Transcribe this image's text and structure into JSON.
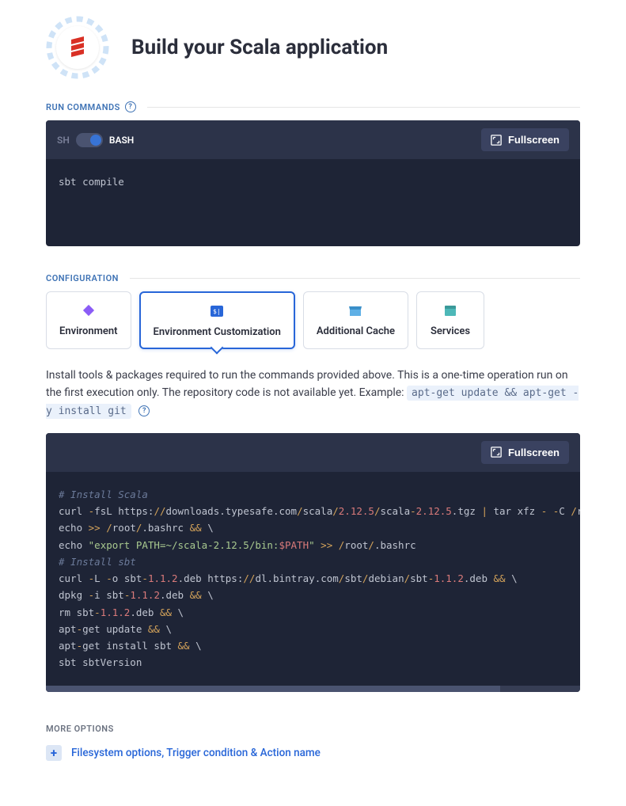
{
  "header": {
    "title": "Build your Scala application"
  },
  "run_commands": {
    "section_label": "RUN COMMANDS",
    "sh_label": "SH",
    "bash_label": "BASH",
    "fullscreen_label": "Fullscreen",
    "content": "sbt compile"
  },
  "configuration": {
    "section_label": "CONFIGURATION",
    "tabs": [
      {
        "label": "Environment"
      },
      {
        "label": "Environment Customization"
      },
      {
        "label": "Additional Cache"
      },
      {
        "label": "Services"
      }
    ],
    "description_prefix": "Install tools & packages required to run the commands provided above. This is a one-time operation run on the first execution only. The repository code is not available yet. Example: ",
    "description_code": "apt-get update && apt-get -y install git",
    "fullscreen_label": "Fullscreen",
    "code_lines": {
      "c1": "# Install Scala",
      "c2_a": "curl ",
      "c2_b": "-",
      "c2_c": "fsL https:",
      "c2_d": "//",
      "c2_e": "downloads.typesafe.com",
      "c2_f": "/",
      "c2_g": "scala",
      "c2_h": "/",
      "c2_i": "2.12.5",
      "c2_j": "/",
      "c2_k": "scala",
      "c2_l": "-",
      "c2_m": "2.12.5",
      "c2_n": ".tgz ",
      "c2_o": "|",
      "c2_p": " tar xfz ",
      "c2_q": "-",
      "c2_r": " ",
      "c2_s": "-",
      "c2_t": "C ",
      "c2_u": "/",
      "c2_v": "root",
      "c3_a": "echo ",
      "c3_b": ">>",
      "c3_c": " ",
      "c3_d": "/",
      "c3_e": "root",
      "c3_f": "/",
      "c3_g": ".bashrc ",
      "c3_h": "&&",
      "c3_i": " \\",
      "c4_a": "echo ",
      "c4_b": "\"export PATH=~/scala-2.12.5/bin:",
      "c4_c": "$PATH",
      "c4_d": "\"",
      "c4_e": " ",
      "c4_f": ">>",
      "c4_g": " ",
      "c4_h": "/",
      "c4_i": "root",
      "c4_j": "/",
      "c4_k": ".bashrc",
      "c5": "# Install sbt",
      "c6_a": "curl ",
      "c6_b": "-",
      "c6_c": "L ",
      "c6_d": "-",
      "c6_e": "o sbt",
      "c6_f": "-",
      "c6_g": "1.1.2",
      "c6_h": ".deb https:",
      "c6_i": "//",
      "c6_j": "dl.bintray.com",
      "c6_k": "/",
      "c6_l": "sbt",
      "c6_m": "/",
      "c6_n": "debian",
      "c6_o": "/",
      "c6_p": "sbt",
      "c6_q": "-",
      "c6_r": "1.1.2",
      "c6_s": ".deb ",
      "c6_t": "&&",
      "c6_u": " \\",
      "c7_a": "dpkg ",
      "c7_b": "-",
      "c7_c": "i sbt",
      "c7_d": "-",
      "c7_e": "1.1.2",
      "c7_f": ".deb ",
      "c7_g": "&&",
      "c7_h": " \\",
      "c8_a": "rm sbt",
      "c8_b": "-",
      "c8_c": "1.1.2",
      "c8_d": ".deb ",
      "c8_e": "&&",
      "c8_f": " \\",
      "c9_a": "apt",
      "c9_b": "-",
      "c9_c": "get update ",
      "c9_d": "&&",
      "c9_e": " \\",
      "c10_a": "apt",
      "c10_b": "-",
      "c10_c": "get install sbt ",
      "c10_d": "&&",
      "c10_e": " \\",
      "c11": "sbt sbtVersion"
    }
  },
  "more_options": {
    "section_label": "MORE OPTIONS",
    "link_text": "Filesystem options, Trigger condition & Action name"
  }
}
